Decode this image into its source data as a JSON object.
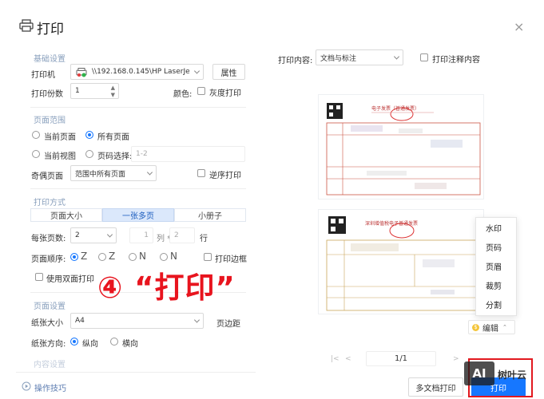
{
  "window": {
    "title": "打印",
    "close_symbol": "×"
  },
  "basic": {
    "section": "基础设置",
    "printer_label": "打印机",
    "printer_value": "\\\\192.168.0.145\\HP LaserJe",
    "properties_button": "属性",
    "copies_label": "打印份数",
    "copies_value": "1",
    "color_label": "颜色:",
    "grayscale_label": "灰度打印"
  },
  "range": {
    "section": "页面范围",
    "current_page": "当前页面",
    "all_pages": "所有页面",
    "current_view": "当前视图",
    "page_select": "页码选择:",
    "page_select_placeholder": "1-2",
    "odd_even_label": "奇偶页面",
    "odd_even_value": "范围中所有页面",
    "reverse_label": "逆序打印"
  },
  "mode": {
    "section": "打印方式",
    "tabs": [
      "页面大小",
      "一张多页",
      "小册子"
    ],
    "per_sheet_label": "每张页数:",
    "per_sheet_value": "2",
    "cols_value": "1",
    "cols_label": "列 *",
    "rows_value": "2",
    "rows_label": "行",
    "order_label": "页面顺序:",
    "order_glyphs": [
      "Z",
      "Z",
      "N",
      "N"
    ],
    "border_label": "打印边框",
    "duplex_label": "使用双面打印"
  },
  "page_setup": {
    "section": "页面设置",
    "paper_size_label": "纸张大小",
    "paper_size_value": "A4",
    "margins_button": "页边距",
    "orientation_label": "纸张方向:",
    "portrait": "纵向",
    "landscape": "横向",
    "next_section": "内容设置"
  },
  "content": {
    "label": "打印内容:",
    "value": "文档与标注",
    "annot_label": "打印注释内容"
  },
  "preview": {
    "doc1_title": "电子发票（普通发票）",
    "doc2_title": "深圳增值税电子普通发票",
    "page_indicator": "1/1"
  },
  "edit_menu": {
    "items": [
      "水印",
      "页码",
      "页眉",
      "裁剪",
      "分割"
    ],
    "edit_button": "编辑",
    "edit_badge": "$"
  },
  "footer": {
    "tips": "操作技巧",
    "multi_print": "多文档打印",
    "print": "打印"
  },
  "overlay": {
    "text": "④ “打印”"
  },
  "watermark": {
    "logo": "AI",
    "brand": "树叶云"
  },
  "colors": {
    "accent": "#1677ff",
    "overlay_red": "#e8141e",
    "selected_tab": "#dbe8fb"
  }
}
